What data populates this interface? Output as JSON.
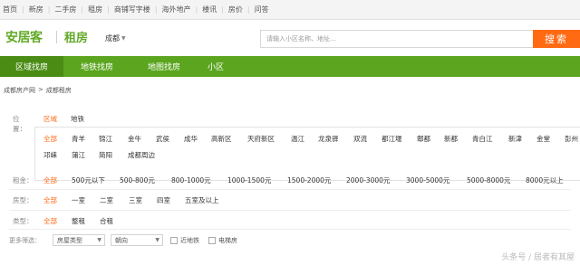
{
  "topnav": [
    "首页",
    "新房",
    "二手房",
    "租房",
    "商铺写字楼",
    "海外地产",
    "楼讯",
    "房价",
    "问答"
  ],
  "header": {
    "logo": "安居客",
    "channel": "租房",
    "city": "成都",
    "search_placeholder": "请输入小区名称、地址...",
    "search_button": "搜索"
  },
  "menu": [
    "区域找房",
    "地铁找房",
    "地图找房",
    "小区"
  ],
  "breadcrumb": [
    "成都房产网",
    ">",
    "成都租房"
  ],
  "filter": {
    "position_label": "位置：",
    "tabs": [
      "区域",
      "地铁"
    ],
    "districts": [
      "全部",
      "青羊",
      "锦江",
      "金牛",
      "武侯",
      "成华",
      "高新区",
      "天府新区",
      "温江",
      "龙泉驿",
      "双流",
      "都江堰",
      "郫都",
      "新都",
      "青白江",
      "新津",
      "金堂",
      "彭州",
      "邛崃",
      "蒲江",
      "简阳",
      "成都周边"
    ],
    "rent_label": "租金：",
    "rents": [
      "全部",
      "500元以下",
      "500-800元",
      "800-1000元",
      "1000-1500元",
      "1500-2000元",
      "2000-3000元",
      "3000-5000元",
      "5000-8000元",
      "8000元以上"
    ],
    "type_label": "房型：",
    "types": [
      "全部",
      "一室",
      "二室",
      "三室",
      "四室",
      "五室及以上"
    ],
    "rentway_label": "类型：",
    "rentways": [
      "全部",
      "整租",
      "合租"
    ],
    "more_label": "更多筛选：",
    "more_select1": "房屋类型",
    "more_select2": "朝向",
    "near_subway": "近地铁",
    "elevator": "电梯房"
  },
  "watermark": "头条号 / 居者有其屋",
  "colors": {
    "brand_green": "#5ba51f",
    "accent_orange": "#ff6a13"
  }
}
